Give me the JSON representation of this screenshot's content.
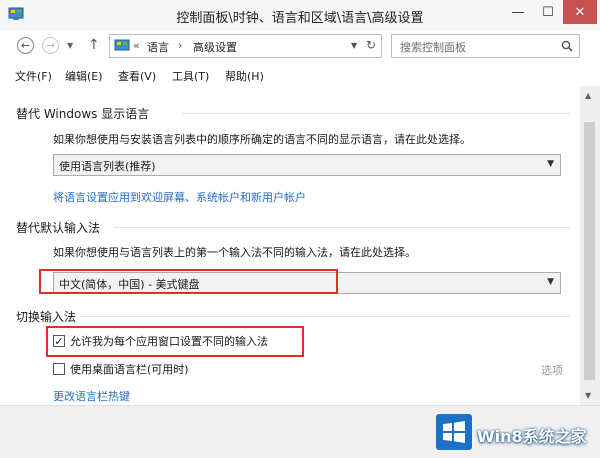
{
  "window": {
    "title": "控制面板\\时钟、语言和区域\\语言\\高级设置",
    "minimize_glyph": "—",
    "maximize_glyph": "☐",
    "close_glyph": "✕"
  },
  "nav": {
    "back_glyph": "←",
    "forward_glyph": "→",
    "up_glyph": "↑",
    "breadcrumb_prefix": "«",
    "breadcrumb": [
      "语言",
      "高级设置"
    ],
    "breadcrumb_separator": "›",
    "search_placeholder": "搜索控制面板"
  },
  "menu": [
    "文件(F)",
    "编辑(E)",
    "查看(V)",
    "工具(T)",
    "帮助(H)"
  ],
  "content": {
    "display_language": {
      "header": "替代 Windows 显示语言",
      "description": "如果你想使用与安装语言列表中的顺序所确定的语言不同的显示语言，请在此处选择。",
      "selected": "使用语言列表(推荐)",
      "link": "将语言设置应用到欢迎屏幕、系统帐户和新用户帐户"
    },
    "default_input": {
      "header": "替代默认输入法",
      "description": "如果你想使用与语言列表上的第一个输入法不同的输入法，请在此处选择。",
      "selected": "中文(简体，中国) - 美式键盘"
    },
    "switch_input": {
      "header": "切换输入法",
      "per_app_label": "允许我为每个应用窗口设置不同的输入法",
      "per_app_checked": true,
      "desktop_bar_label": "使用桌面语言栏(可用时)",
      "desktop_bar_checked": false,
      "options_label": "选项",
      "hotkeys_link": "更改语言栏热键"
    }
  },
  "watermark": {
    "text": "Win8系统之家",
    "color": "#1b70c7"
  },
  "colors": {
    "highlight_border": "#e22b2b",
    "link": "#2a6fc1",
    "close_button": "#c75050"
  }
}
